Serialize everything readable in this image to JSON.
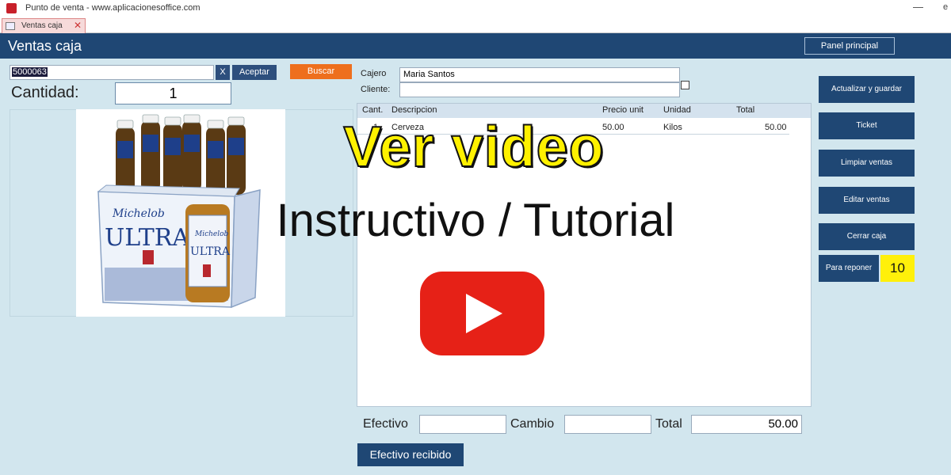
{
  "window": {
    "title": "Punto de venta - www.aplicacionesoffice.com",
    "min_glyph": "—",
    "extra_glyph": "e"
  },
  "tab": {
    "label": "Ventas caja",
    "close_glyph": "✕"
  },
  "header": {
    "title": "Ventas caja",
    "panel_button": "Panel principal"
  },
  "form": {
    "code_value": "5000063",
    "clear_label": "X",
    "accept_label": "Aceptar",
    "search_label": "Buscar",
    "quantity_label": "Cantidad:",
    "quantity_value": "1",
    "cashier_label": "Cajero",
    "cashier_value": "Maria Santos",
    "client_label": "Cliente:"
  },
  "table": {
    "headers": {
      "qty": "Cant.",
      "description": "Descripcion",
      "unit_price": "Precio unit",
      "unit": "Unidad",
      "total": "Total"
    },
    "rows": [
      {
        "qty": "1",
        "description": "Cerveza",
        "unit_price": "50.00",
        "unit": "Kilos",
        "total": "50.00"
      }
    ]
  },
  "totals": {
    "cash_label": "Efectivo",
    "change_label": "Cambio",
    "total_label": "Total",
    "total_value": "50.00",
    "received_button": "Efectivo recibido"
  },
  "actions": {
    "update_save": "Actualizar y guardar",
    "ticket": "Ticket",
    "clear_sales": "Limpiar ventas",
    "edit_sales": "Editar ventas",
    "close_register": "Cerrar caja",
    "restock": "Para reponer",
    "restock_count": "10"
  },
  "overlay": {
    "headline": "Ver video",
    "subtitle": "Instructivo / Tutorial",
    "icon": "youtube-play-icon"
  },
  "product_image": {
    "brand_script": "Michelob",
    "brand_name": "ULTRA",
    "icon": "six-pack-beer-image"
  },
  "colors": {
    "accent": "#1f4774",
    "search": "#ee6f1d",
    "badge": "#fff00a",
    "youtube": "#e62117",
    "headline": "#fff100"
  }
}
